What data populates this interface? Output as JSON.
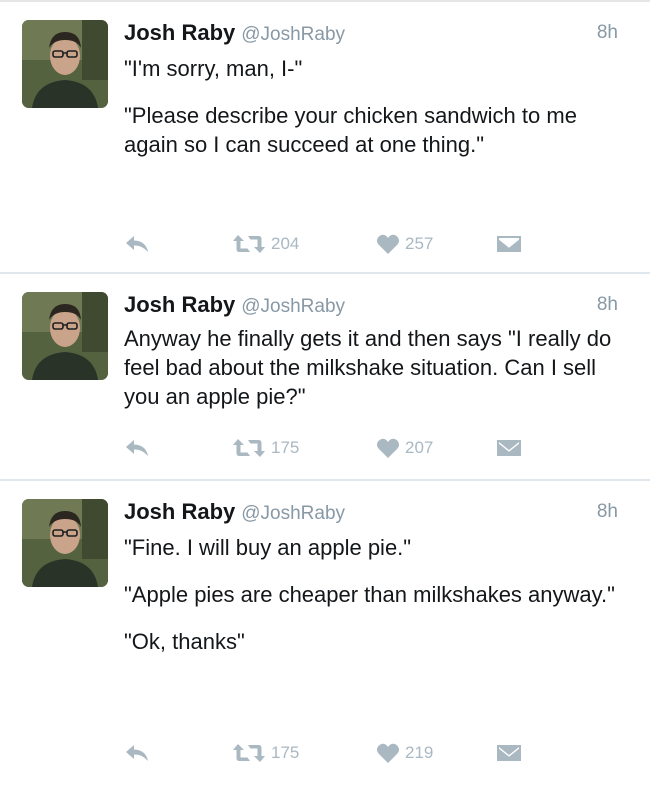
{
  "colors": {
    "text": "#14171a",
    "secondary": "#8899a6",
    "action_icon": "#aab8c2",
    "divider": "#e1e8ed"
  },
  "icons": {
    "reply": "reply-icon",
    "retweet": "retweet-icon",
    "like": "heart-icon",
    "message": "envelope-icon"
  },
  "tweets": [
    {
      "name": "Josh Raby",
      "handle": "@JoshRaby",
      "time": "8h",
      "paragraphs": [
        "\"I'm sorry, man, I-\"",
        "\"Please describe your chicken sandwich to me again so I can succeed at one thing.\""
      ],
      "retweets": "204",
      "likes": "257"
    },
    {
      "name": "Josh Raby",
      "handle": "@JoshRaby",
      "time": "8h",
      "paragraphs": [
        "Anyway he finally gets it and then says \"I really do feel bad about the milkshake situation. Can I sell you an apple pie?\""
      ],
      "retweets": "175",
      "likes": "207"
    },
    {
      "name": "Josh Raby",
      "handle": "@JoshRaby",
      "time": "8h",
      "paragraphs": [
        "\"Fine. I will buy an apple pie.\"",
        "\"Apple pies are cheaper than milkshakes anyway.\"",
        "\"Ok, thanks\""
      ],
      "retweets": "175",
      "likes": "219"
    }
  ]
}
